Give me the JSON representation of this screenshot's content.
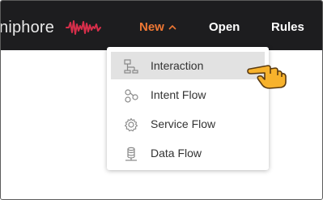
{
  "brand": {
    "text": "niphore",
    "accent": "#d62e4a"
  },
  "nav": {
    "items": [
      {
        "label": "New",
        "color": "#ee7734"
      },
      {
        "label": "Open"
      },
      {
        "label": "Rules"
      }
    ]
  },
  "menu": {
    "items": [
      {
        "label": "Interaction",
        "icon": "interaction-icon",
        "highlighted": true
      },
      {
        "label": "Intent Flow",
        "icon": "intent-flow-icon"
      },
      {
        "label": "Service Flow",
        "icon": "gear-icon"
      },
      {
        "label": "Data Flow",
        "icon": "database-icon"
      }
    ]
  },
  "colors": {
    "topbar": "#1d1d1f",
    "active_nav": "#ee7734",
    "highlight": "#e2e2e2"
  }
}
